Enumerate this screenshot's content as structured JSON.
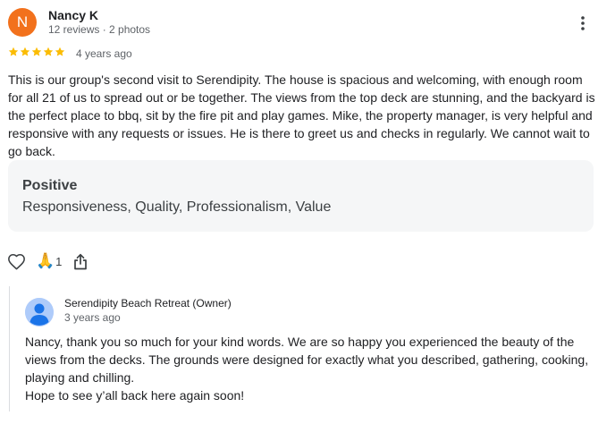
{
  "review": {
    "author": {
      "initial": "N",
      "name": "Nancy K",
      "meta": "12 reviews · 2 photos"
    },
    "rating": 5,
    "rating_max": 5,
    "star_color": "#fbbc04",
    "avatar_color": "#f2711c",
    "time": "4 years ago",
    "text": "This is our group's second visit to Serendipity. The house is spacious and welcoming, with enough room for all 21 of us to spread out or be together. The views from the top deck are stunning, and the backyard is the perfect place to bbq, sit by the fire pit and play games. Mike, the property manager, is very helpful and responsive with any requests or issues. He is there to greet us and checks in regularly. We cannot wait to go back.",
    "attributes": {
      "title": "Positive",
      "values": "Responsiveness, Quality, Professionalism, Value"
    },
    "actions": {
      "like_icon": "heart-outline-icon",
      "reaction_icon": "folded-hands-emoji",
      "reaction_emoji": "🙏",
      "reaction_count": "1",
      "share_icon": "share-icon"
    },
    "more_icon": "vertical-dots-icon"
  },
  "owner_reply": {
    "name": "Serendipity Beach Retreat (Owner)",
    "time": "3 years ago",
    "lines": [
      "Nancy, thank you so much for your kind words. We are so happy you experienced the beauty of the views from the decks. The grounds were designed for exactly what you described, gathering, cooking, playing and chilling.",
      "Hope to see y’all back here again soon!"
    ],
    "avatar_icon": "default-profile-icon"
  }
}
